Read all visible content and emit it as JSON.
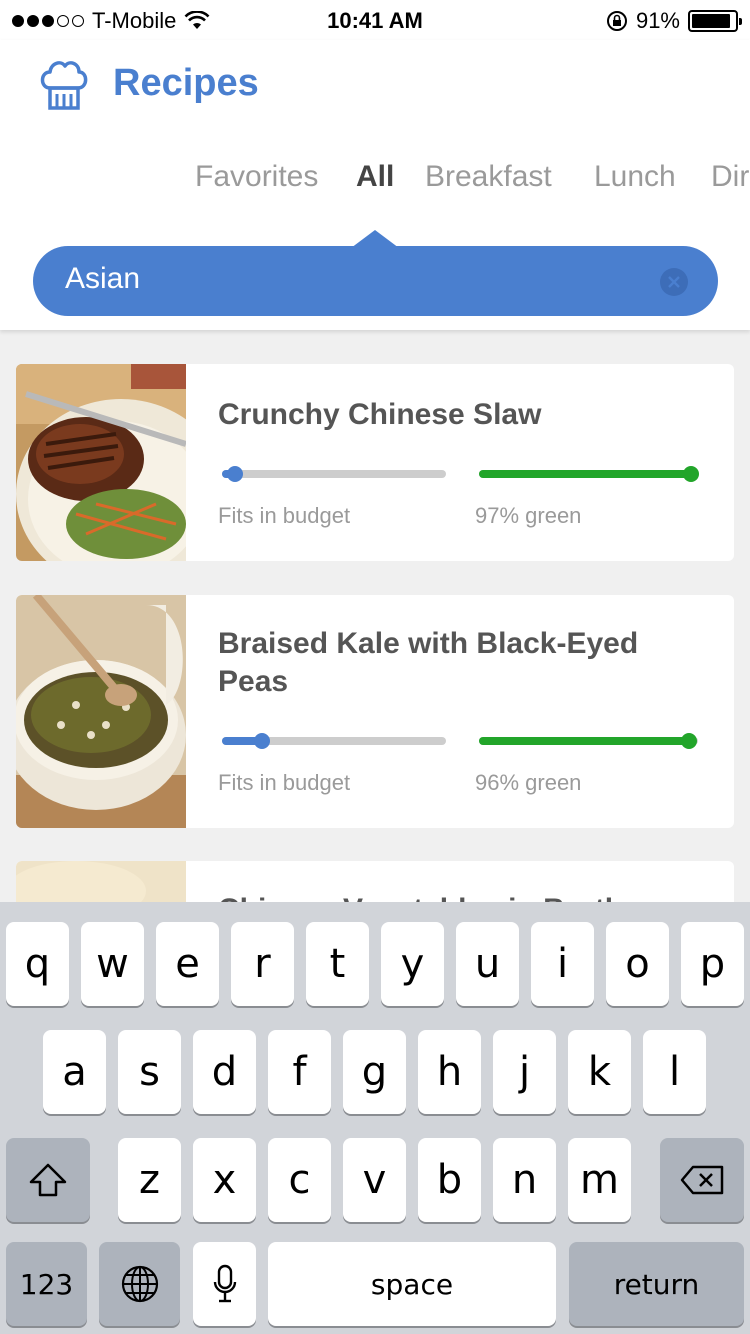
{
  "status_bar": {
    "carrier": "T-Mobile",
    "time": "10:41 AM",
    "battery": "91%",
    "battery_level": 0.91
  },
  "header": {
    "title": "Recipes",
    "logo_icon": "chef-hat-icon"
  },
  "tabs": [
    "Favorites",
    "All",
    "Breakfast",
    "Lunch",
    "Dir"
  ],
  "active_tab": "All",
  "search": {
    "value": "Asian",
    "clear_icon": "clear-icon"
  },
  "recipes": [
    {
      "title": "Crunchy Chinese Slaw",
      "budget_label": "Fits in budget",
      "budget_level": 0.06,
      "green_label": "97% green",
      "green_level": 0.97
    },
    {
      "title": "Braised Kale with Black-Eyed Peas",
      "budget_label": "Fits in budget",
      "budget_level": 0.18,
      "green_label": "96% green",
      "green_level": 0.96
    },
    {
      "title": "Chinese Vegetables in Broth"
    }
  ],
  "keyboard": {
    "row1": [
      "q",
      "w",
      "e",
      "r",
      "t",
      "y",
      "u",
      "i",
      "o",
      "p"
    ],
    "row2": [
      "a",
      "s",
      "d",
      "f",
      "g",
      "h",
      "j",
      "k",
      "l"
    ],
    "row3": [
      "z",
      "x",
      "c",
      "v",
      "b",
      "n",
      "m"
    ],
    "numbers_label": "123",
    "space_label": "space",
    "return_label": "return"
  },
  "colors": {
    "accent": "#4a7fcf",
    "green": "#22a52a",
    "track": "#cdcdcd"
  }
}
